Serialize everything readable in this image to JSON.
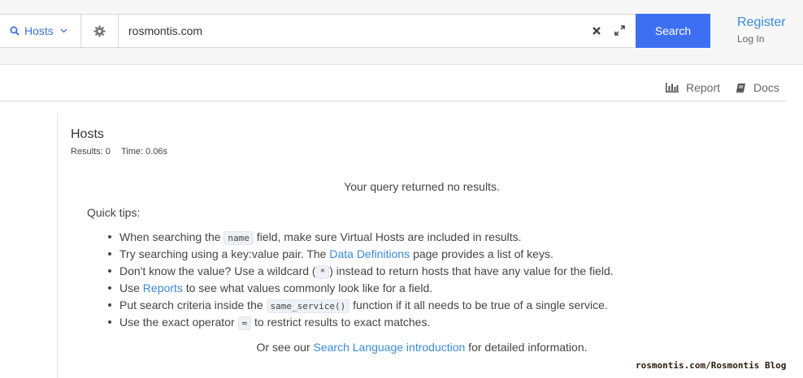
{
  "header": {
    "search_type": "Hosts",
    "query": "rosmontis.com",
    "search_label": "Search",
    "register_label": "Register",
    "login_label": "Log In"
  },
  "toolbar": {
    "report_label": "Report",
    "docs_label": "Docs"
  },
  "results": {
    "title": "Hosts",
    "count_text": "Results: 0",
    "time_text": "Time: 0.06s",
    "no_results": "Your query returned no results."
  },
  "tips": {
    "heading": "Quick tips:",
    "items": [
      {
        "a": "When searching the ",
        "code": "name",
        "b": " field, make sure Virtual Hosts are included in results."
      },
      {
        "a": "Try searching using a key:value pair. The ",
        "link": "Data Definitions",
        "b": " page provides a list of keys."
      },
      {
        "a": "Don't know the value? Use a wildcard (",
        "code": "*",
        "b": ") instead to return hosts that have any value for the field."
      },
      {
        "a": "Use ",
        "link": "Reports",
        "b": " to see what values commonly look like for a field."
      },
      {
        "a": "Put search criteria inside the ",
        "code": "same_service()",
        "b": " function if it all needs to be true of a single service."
      },
      {
        "a": "Use the exact operator ",
        "code": "=",
        "b": " to restrict results to exact matches."
      }
    ],
    "footer_prefix": "Or see our ",
    "footer_link": "Search Language introduction",
    "footer_suffix": " for detailed information."
  },
  "watermark": "rosmontis.com/Rosmontis Blog",
  "colors": {
    "accent": "#3d6ff2",
    "link": "#3b8ad8"
  },
  "icons": {
    "search_type": "search-icon",
    "dropdown": "chevron-down-icon",
    "settings": "gear-icon",
    "clear": "close-icon",
    "expand": "expand-icon",
    "report": "bar-chart-icon",
    "docs": "book-icon"
  }
}
